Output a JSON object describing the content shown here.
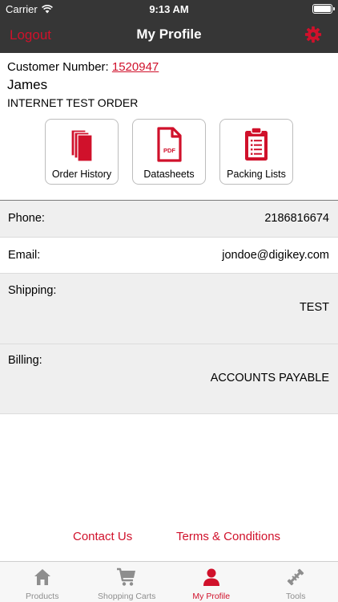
{
  "status_bar": {
    "carrier": "Carrier",
    "time": "9:13 AM"
  },
  "nav": {
    "logout_label": "Logout",
    "title": "My Profile",
    "settings_icon": "gear-icon"
  },
  "customer": {
    "number_label": "Customer Number:",
    "number": "1520947",
    "name": "James",
    "order_name": "INTERNET TEST ORDER"
  },
  "tiles": [
    {
      "label": "Order History",
      "icon": "documents-icon"
    },
    {
      "label": "Datasheets",
      "icon": "pdf-icon",
      "icon_text": "PDF"
    },
    {
      "label": "Packing Lists",
      "icon": "clipboard-icon"
    }
  ],
  "details": {
    "phone_label": "Phone:",
    "phone": "2186816674",
    "email_label": "Email:",
    "email": "jondoe@digikey.com",
    "shipping_label": "Shipping:",
    "shipping": "TEST",
    "billing_label": "Billing:",
    "billing": "ACCOUNTS PAYABLE"
  },
  "footer": {
    "contact_label": "Contact Us",
    "terms_label": "Terms & Conditions"
  },
  "tabs": [
    {
      "label": "Products",
      "icon": "home-icon",
      "active": false
    },
    {
      "label": "Shopping Carts",
      "icon": "cart-icon",
      "active": false
    },
    {
      "label": "My Profile",
      "icon": "user-icon",
      "active": true
    },
    {
      "label": "Tools",
      "icon": "tools-icon",
      "active": false
    }
  ],
  "colors": {
    "accent": "#d0112b",
    "bar": "#363636",
    "row_gray": "#efefef",
    "tab_inactive": "#8e8e8e"
  }
}
